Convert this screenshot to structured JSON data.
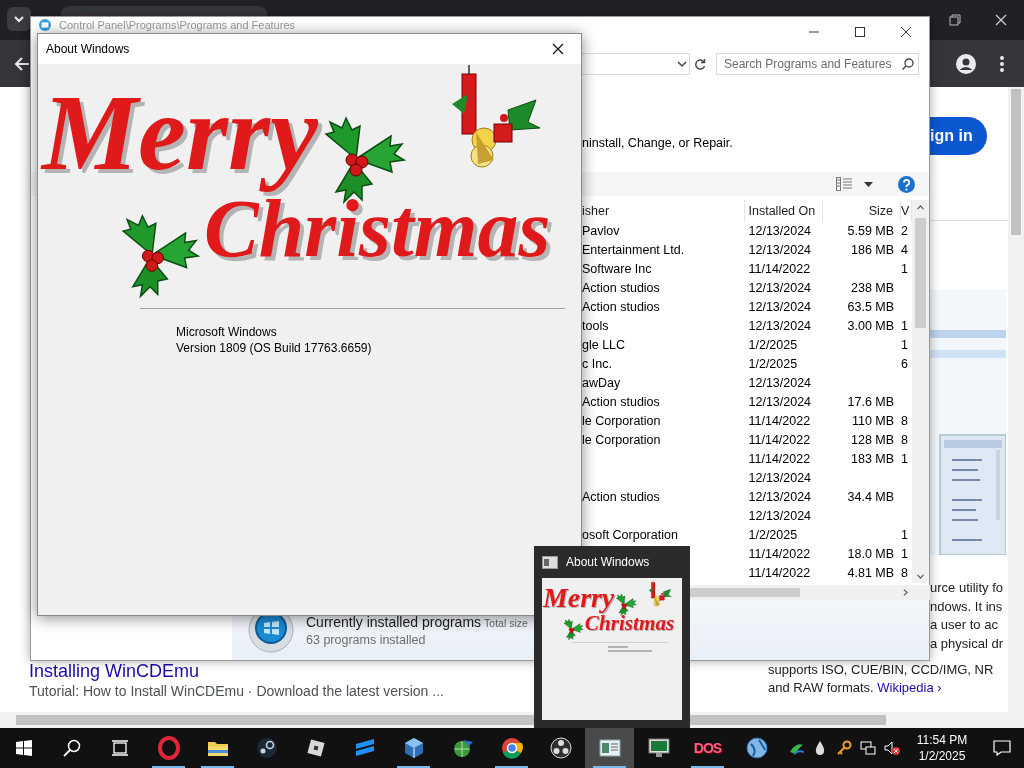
{
  "browser": {
    "sign_in": "ign in",
    "panel_lines": [
      "urce utility fo",
      "ndows. It ins",
      "a user to ac",
      "a physical dr"
    ],
    "wide_line": "supports ISO, CUE/BIN, CCD/IMG, NR",
    "last_line": {
      "text": "and RAW formats.",
      "link": "Wikipedia ›"
    },
    "result_title": "Installing WinCDEmu",
    "result_snippet": "Tutorial: How to Install WinCDEmu · Download the latest version ..."
  },
  "control_panel": {
    "title": "Control Panel\\Programs\\Programs and Features",
    "search": {
      "placeholder": "Search Programs and Features"
    },
    "hint": "ninstall, Change, or Repair.",
    "columns": [
      "isher",
      "Installed On",
      "Size",
      "V"
    ],
    "rows": [
      {
        "publisher": "Pavlov",
        "installed_on": "12/13/2024",
        "size": "5.59 MB",
        "column_4": "2"
      },
      {
        "publisher": "Entertainment Ltd.",
        "installed_on": "12/13/2024",
        "size": "186 MB",
        "column_4": "4"
      },
      {
        "publisher": "Software Inc",
        "installed_on": "11/14/2022",
        "column_4": "1"
      },
      {
        "publisher": "Action studios",
        "installed_on": "12/13/2024",
        "size": "238 MB"
      },
      {
        "publisher": "Action studios",
        "installed_on": "12/13/2024",
        "size": "63.5 MB"
      },
      {
        "publisher": "tools",
        "installed_on": "12/13/2024",
        "size": "3.00 MB",
        "column_4": "1"
      },
      {
        "publisher": "gle LLC",
        "installed_on": "1/2/2025",
        "column_4": "1"
      },
      {
        "publisher": "c Inc.",
        "installed_on": "1/2/2025",
        "column_4": "6"
      },
      {
        "publisher": "awDay",
        "installed_on": "12/13/2024"
      },
      {
        "publisher": "Action studios",
        "installed_on": "12/13/2024",
        "size": "17.6 MB"
      },
      {
        "publisher": "le Corporation",
        "installed_on": "11/14/2022",
        "size": "110 MB",
        "column_4": "8"
      },
      {
        "publisher": "le Corporation",
        "installed_on": "11/14/2022",
        "size": "128 MB",
        "column_4": "8"
      },
      {
        "installed_on": "11/14/2022",
        "size": "183 MB",
        "column_4": "1"
      },
      {
        "installed_on": "12/13/2024"
      },
      {
        "publisher": "Action studios",
        "installed_on": "12/13/2024",
        "size": "34.4 MB"
      },
      {
        "installed_on": "12/13/2024"
      },
      {
        "publisher": "osoft Corporation",
        "installed_on": "1/2/2025",
        "column_4": "1"
      },
      {
        "installed_on": "11/14/2022",
        "size": "18.0 MB",
        "column_4": "1"
      },
      {
        "installed_on": "11/14/2022",
        "size": "4.81 MB",
        "column_4": "8"
      }
    ],
    "details": {
      "title": "Currently installed programs",
      "total": "Total size",
      "count": "63 programs installed"
    }
  },
  "about": {
    "title": "About Windows",
    "banner": [
      "Merry",
      "Christmas"
    ],
    "product": "Microsoft Windows",
    "version": "Version 1809 (OS Build 17763.6659)"
  },
  "preview": {
    "title": "About Windows",
    "banner": [
      "Merry",
      "Christmas"
    ]
  },
  "taskbar": {
    "apps": [
      {
        "kind": "opera",
        "running": true,
        "selected": false
      },
      {
        "kind": "folder",
        "running": true,
        "selected": false
      },
      {
        "kind": "steam",
        "running": false,
        "selected": false
      },
      {
        "kind": "roblox",
        "running": false,
        "selected": false
      },
      {
        "kind": "stripes",
        "running": false,
        "selected": false
      },
      {
        "kind": "cube",
        "running": true,
        "selected": false
      },
      {
        "kind": "download",
        "running": false,
        "selected": false
      },
      {
        "kind": "chrome",
        "running": true,
        "selected": false
      },
      {
        "kind": "obs",
        "running": false,
        "selected": false
      },
      {
        "kind": "panel",
        "running": true,
        "selected": true
      },
      {
        "kind": "monitor",
        "running": false,
        "selected": false
      },
      {
        "kind": "dos",
        "label": "DOS",
        "running": true,
        "selected": false
      },
      {
        "kind": "globe",
        "running": false,
        "selected": false
      }
    ],
    "time": "11:54 PM",
    "date": "1/2/2025"
  }
}
